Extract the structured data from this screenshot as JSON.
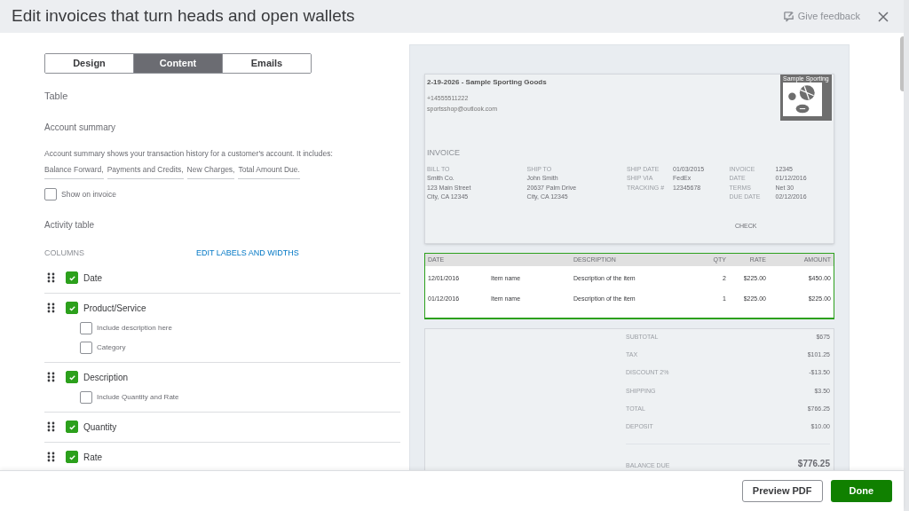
{
  "window": {
    "title": "Edit invoices that turn heads and open wallets",
    "feedback": "Give feedback"
  },
  "tabs": [
    {
      "label": "Design",
      "selected": false
    },
    {
      "label": "Content",
      "selected": true
    },
    {
      "label": "Emails",
      "selected": false
    }
  ],
  "section_title": "Table",
  "account_summary": {
    "title": "Account summary",
    "description": "Account summary shows your transaction history for a customer's account. It includes:",
    "terms": [
      "Balance Forward,",
      "Payments and Credits,",
      "New Charges,",
      "Total Amount Due."
    ],
    "show_on_invoice": {
      "label": "Show on invoice",
      "checked": false
    }
  },
  "activity_table": {
    "title": "Activity table",
    "columns_label": "COLUMNS",
    "edit_link": "EDIT LABELS AND WIDTHS",
    "columns": [
      {
        "label": "Date",
        "checked": true
      },
      {
        "label": "Product/Service",
        "checked": true,
        "options": [
          {
            "label": "Include description here",
            "checked": false
          },
          {
            "label": "Category",
            "checked": false
          }
        ]
      },
      {
        "label": "Description",
        "checked": true,
        "options": [
          {
            "label": "Include Quantity and Rate",
            "checked": false
          }
        ]
      },
      {
        "label": "Quantity",
        "checked": true
      },
      {
        "label": "Rate",
        "checked": true
      }
    ]
  },
  "preview": {
    "company": "2-19-2026 - Sample Sporting Goods",
    "phone": "+14555511222",
    "email": "sportsshop@outlook.com",
    "logo_caption": "Sample Sporting",
    "heading": "INVOICE",
    "address_blocks": [
      {
        "label": "BILL TO",
        "lines": [
          "Smith Co.",
          "123 Main Street",
          "City, CA 12345"
        ]
      },
      {
        "label": "SHIP TO",
        "lines": [
          "John Smith",
          "20637 Palm Drive",
          "City, CA 12345"
        ]
      }
    ],
    "info_blocks": [
      [
        {
          "label": "SHIP DATE",
          "value": "01/03/2015"
        },
        {
          "label": "SHIP VIA",
          "value": "FedEx"
        },
        {
          "label": "TRACKING #",
          "value": "12345678"
        }
      ],
      [
        {
          "label": "INVOICE",
          "value": "12345"
        },
        {
          "label": "DATE",
          "value": "01/12/2016"
        },
        {
          "label": "TERMS",
          "value": "Net 30"
        },
        {
          "label": "DUE DATE",
          "value": "02/12/2016"
        }
      ]
    ],
    "payment": "CHECK",
    "table": {
      "columns": [
        "DATE",
        "",
        "DESCRIPTION",
        "QTY",
        "RATE",
        "AMOUNT"
      ],
      "rows": [
        [
          "12/01/2016",
          "Item name",
          "Description of the item",
          "2",
          "$225.00",
          "$450.00"
        ],
        [
          "01/12/2016",
          "Item name",
          "Description of the item",
          "1",
          "$225.00",
          "$225.00"
        ]
      ]
    },
    "totals": [
      {
        "label": "SUBTOTAL",
        "value": "$675"
      },
      {
        "label": "TAX",
        "value": "$101.25"
      },
      {
        "label": "DISCOUNT 2%",
        "value": "-$13.50"
      },
      {
        "label": "SHIPPING",
        "value": "$3.50"
      },
      {
        "label": "TOTAL",
        "value": "$766.25"
      },
      {
        "label": "DEPOSIT",
        "value": "$10.00"
      }
    ],
    "balance_due": {
      "label": "BALANCE DUE",
      "value": "$776.25"
    }
  },
  "footer": {
    "buttons": [
      "Preview PDF",
      "Done"
    ]
  }
}
